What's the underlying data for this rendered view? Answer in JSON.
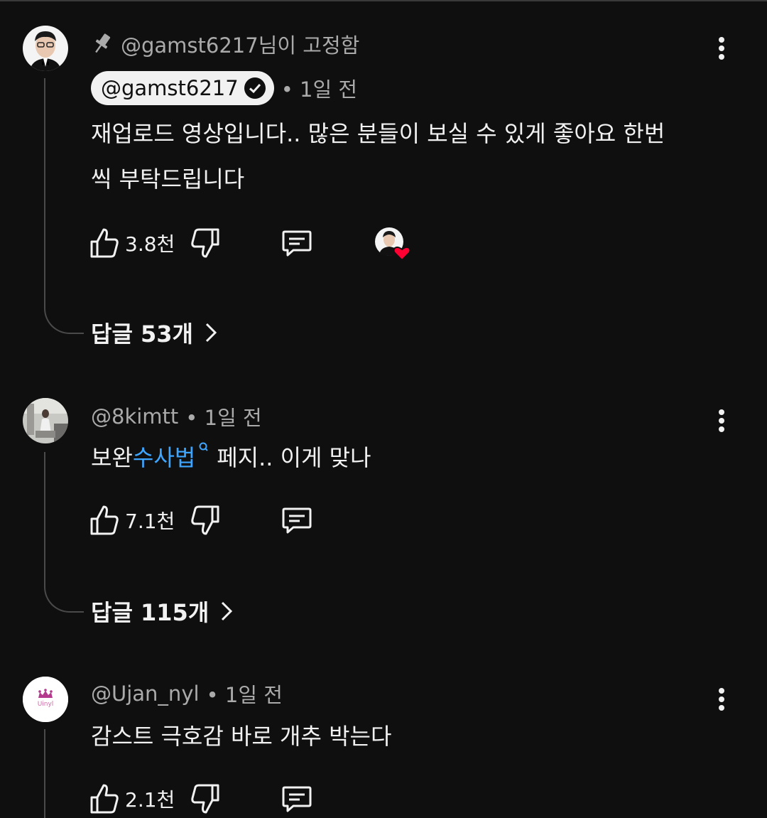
{
  "comments": [
    {
      "pinned_label": "@gamst6217님이 고정함",
      "author": "@gamst6217",
      "time": "• 1일 전",
      "text_line1": "재업로드 영상입니다.. 많은 분들이 보실 수 있게 좋아요 한번",
      "text_line2": "씩 부탁드립니다",
      "likes": "3.8천",
      "replies": "답글 53개"
    },
    {
      "author": "@8kimtt",
      "time": "• 1일 전",
      "text_before": "보완",
      "text_link": "수사법",
      "text_after": "페지.. 이게 맞나",
      "likes": "7.1천",
      "replies": "답글 115개"
    },
    {
      "author": "@Ujan_nyl",
      "time": "• 1일 전",
      "text": "감스트 극호감 바로 개추 박는다",
      "likes": "2.1천",
      "avatar_text": "Uinyl"
    }
  ],
  "colors": {
    "background": "#0f0f0f",
    "link": "#3ea6ff",
    "heart": "#ff0033"
  }
}
